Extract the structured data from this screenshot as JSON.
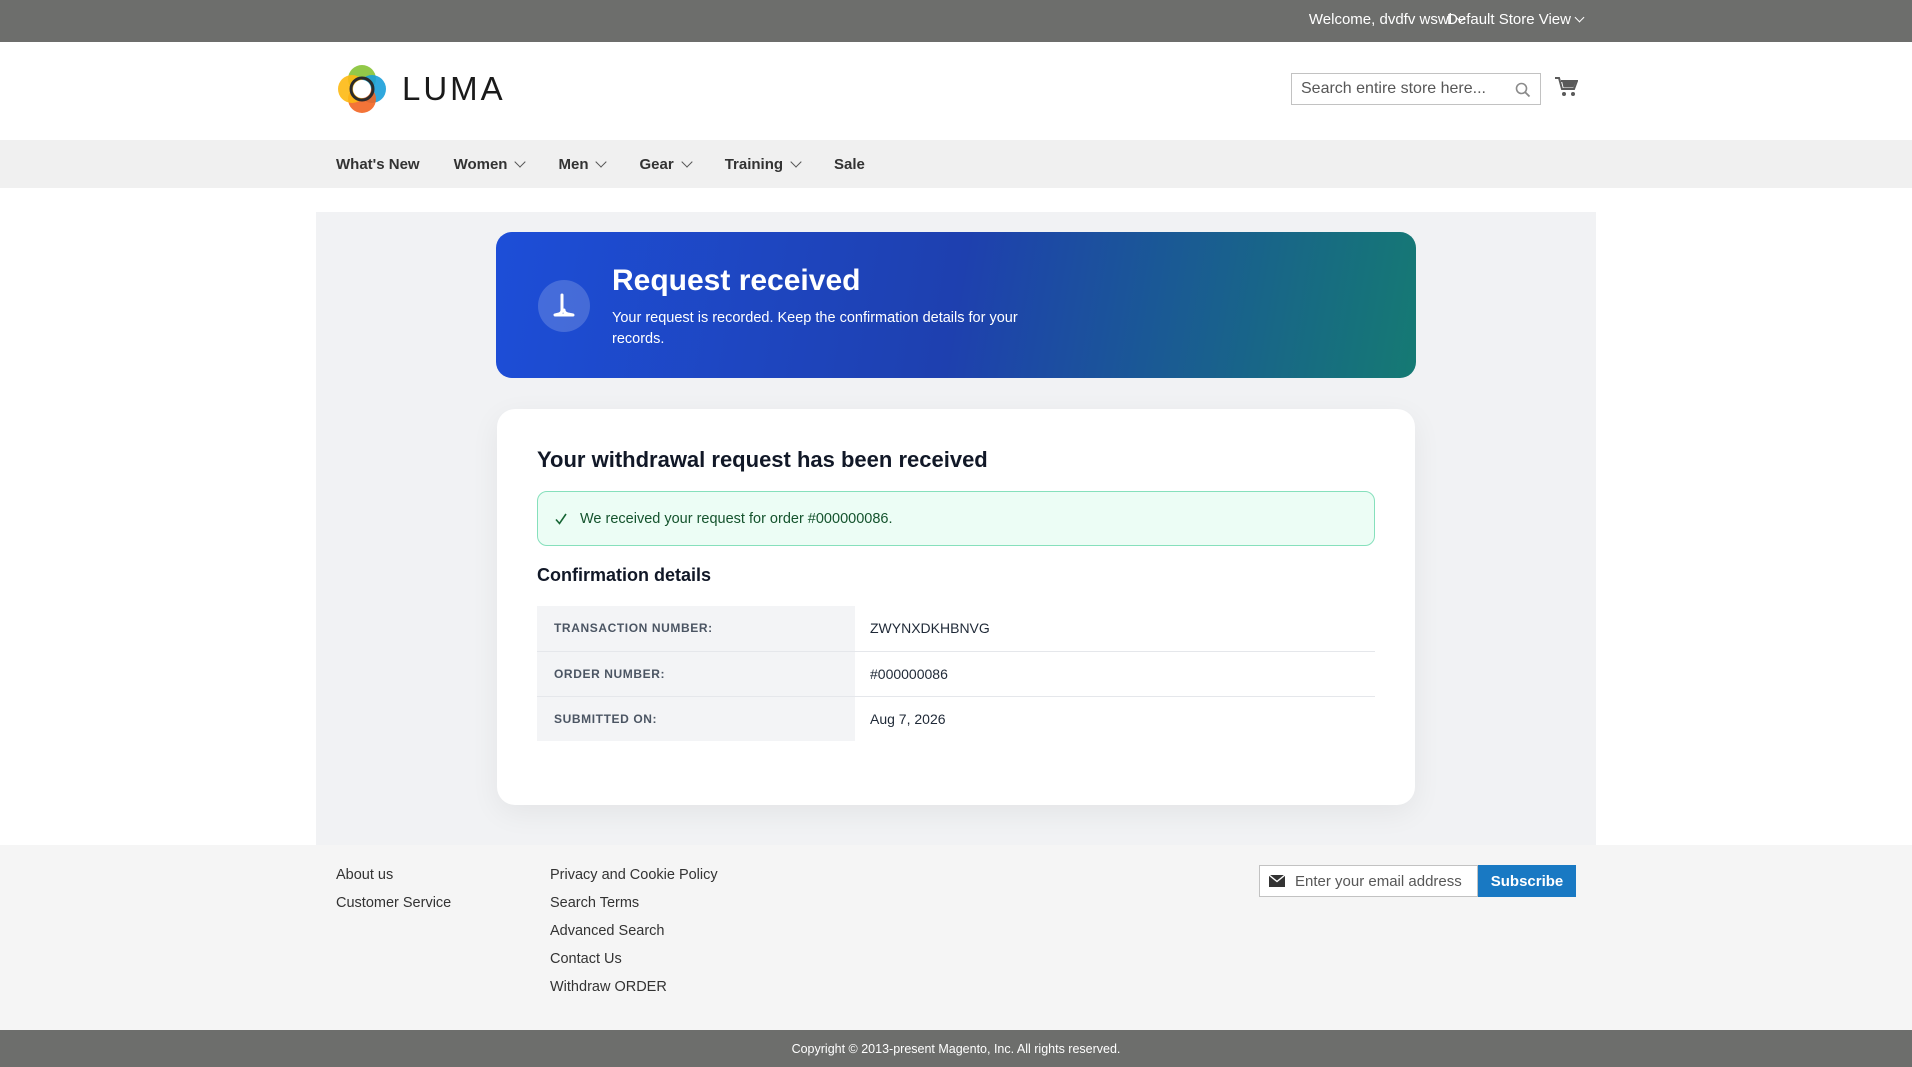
{
  "topbar": {
    "welcome": "Welcome, dvdfv wswl",
    "store_view": "Default Store View"
  },
  "header": {
    "logo_text": "LUMA",
    "search_placeholder": "Search entire store here..."
  },
  "nav": {
    "items": [
      {
        "label": "What's New",
        "has_dropdown": false
      },
      {
        "label": "Women",
        "has_dropdown": true
      },
      {
        "label": "Men",
        "has_dropdown": true
      },
      {
        "label": "Gear",
        "has_dropdown": true
      },
      {
        "label": "Training",
        "has_dropdown": true
      },
      {
        "label": "Sale",
        "has_dropdown": false
      }
    ]
  },
  "hero": {
    "title": "Request received",
    "text": "Your request is recorded. Keep the confirmation details for your records.",
    "icon": "receipt-icon"
  },
  "card": {
    "title": "Your withdrawal request has been received",
    "alert": "We received your request for order #000000086.",
    "details_title": "Confirmation details",
    "rows": [
      {
        "label": "TRANSACTION NUMBER:",
        "value": "ZWYNXDKHBNVG"
      },
      {
        "label": "ORDER NUMBER:",
        "value": "#000000086"
      },
      {
        "label": "SUBMITTED ON:",
        "value": "Aug 7, 2026"
      }
    ]
  },
  "footer": {
    "col1": [
      "About us",
      "Customer Service"
    ],
    "col2": [
      "Privacy and Cookie Policy",
      "Search Terms",
      "Advanced Search",
      "Contact Us",
      "Withdraw ORDER"
    ],
    "newsletter_placeholder": "Enter your email address",
    "subscribe_label": "Subscribe",
    "copyright": "Copyright © 2013-present Magento, Inc. All rights reserved."
  },
  "colors": {
    "topbar": "#6d6e6c",
    "hero_start": "#1d4ed8",
    "hero_end": "#157a73",
    "subscribe": "#1979c3",
    "alert_bg": "#ecfdf5"
  }
}
